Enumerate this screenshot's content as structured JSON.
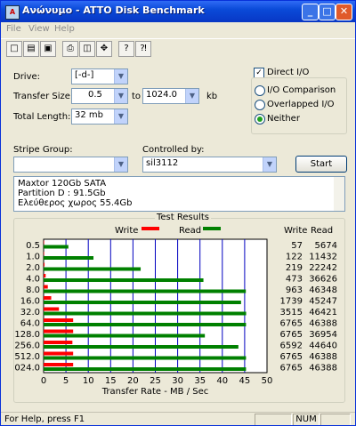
{
  "window": {
    "title": "Ανώνυμο - ATTO Disk Benchmark",
    "minimize": "_",
    "maximize": "□",
    "close": "✕"
  },
  "menu": [
    "File",
    "View",
    "Help"
  ],
  "toolbar": [
    {
      "icon": "new-document-icon",
      "glyph": "□"
    },
    {
      "icon": "open-folder-icon",
      "glyph": "📂"
    },
    {
      "icon": "save-icon",
      "glyph": "▣"
    },
    {
      "icon": "print-icon",
      "glyph": "⎙"
    },
    {
      "icon": "print-preview-icon",
      "glyph": "◫"
    },
    {
      "icon": "move-icon",
      "glyph": "✥"
    },
    {
      "icon": "help-icon",
      "glyph": "?"
    },
    {
      "icon": "context-help-icon",
      "glyph": "⁈"
    }
  ],
  "form": {
    "drive_label": "Drive:",
    "drive_value": "[-d-]",
    "transfer_size_label": "Transfer Size:",
    "transfer_from": "0.5",
    "to_label": "to",
    "transfer_to": "1024.0",
    "kb_label": "kb",
    "total_length_label": "Total Length:",
    "total_length_value": "32 mb",
    "stripe_group_label": "Stripe Group:",
    "stripe_group_value": "",
    "controlled_by_label": "Controlled by:",
    "controlled_by_value": "sil3112",
    "start_label": "Start"
  },
  "options": {
    "direct_io_label": "Direct I/O",
    "direct_io_checked": true,
    "io_comparison_label": "I/O Comparison",
    "overlapped_io_label": "Overlapped I/O",
    "neither_label": "Neither",
    "selected": "neither"
  },
  "info_lines": [
    "Maxtor 120Gb SATA",
    "Partition D : 91.5Gb",
    "Ελεύθερος χωρος 55.4Gb"
  ],
  "results": {
    "title": "Test Results",
    "legend_write": "Write",
    "legend_read": "Read",
    "col_write": "Write",
    "col_read": "Read",
    "rows": [
      {
        "size": "0.5",
        "write": "57",
        "read": "5674"
      },
      {
        "size": "1.0",
        "write": "122",
        "read": "11432"
      },
      {
        "size": "2.0",
        "write": "219",
        "read": "22242"
      },
      {
        "size": "4.0",
        "write": "473",
        "read": "36626"
      },
      {
        "size": "8.0",
        "write": "963",
        "read": "46348"
      },
      {
        "size": "16.0",
        "write": "1739",
        "read": "45247"
      },
      {
        "size": "32.0",
        "write": "3515",
        "read": "46421"
      },
      {
        "size": "64.0",
        "write": "6765",
        "read": "46388"
      },
      {
        "size": "128.0",
        "write": "6765",
        "read": "36954"
      },
      {
        "size": "256.0",
        "write": "6592",
        "read": "44640"
      },
      {
        "size": "512.0",
        "write": "6765",
        "read": "46388"
      },
      {
        "size": "1024.0",
        "write": "6765",
        "read": "46388"
      }
    ]
  },
  "chart_data": {
    "type": "bar",
    "orientation": "horizontal",
    "title": "Test Results",
    "xlabel": "Transfer Rate - MB / Sec",
    "xlim": [
      0,
      50
    ],
    "xticks": [
      "0",
      "5",
      "10",
      "15",
      "20",
      "25",
      "30",
      "35",
      "40",
      "45",
      "50"
    ],
    "categories": [
      "0.5",
      "1.0",
      "2.0",
      "4.0",
      "8.0",
      "16.0",
      "32.0",
      "64.0",
      "128.0",
      "256.0",
      "512.0",
      "1024.0"
    ],
    "series": [
      {
        "name": "Write",
        "color": "#ff0000",
        "values": [
          0.06,
          0.12,
          0.21,
          0.46,
          0.94,
          1.7,
          3.43,
          6.61,
          6.61,
          6.44,
          6.61,
          6.61
        ]
      },
      {
        "name": "Read",
        "color": "#008000",
        "values": [
          5.54,
          11.16,
          21.72,
          35.77,
          45.26,
          44.19,
          45.33,
          45.3,
          36.09,
          43.59,
          45.3,
          45.3
        ]
      }
    ],
    "grid": true,
    "legend": "top"
  },
  "status": {
    "text": "For Help, press F1",
    "num": "NUM"
  }
}
